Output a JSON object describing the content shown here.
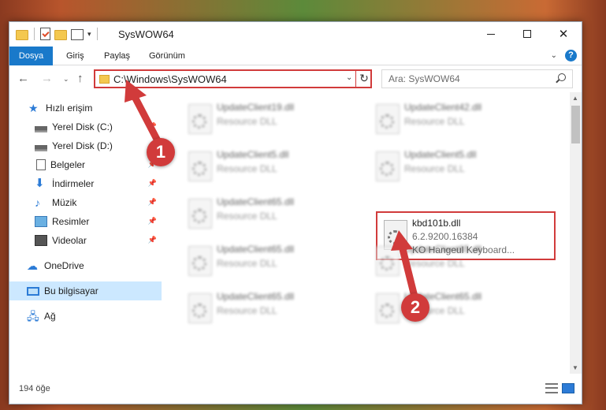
{
  "window": {
    "title": "SysWOW64",
    "controls": {
      "minimize": "–",
      "maximize": "□",
      "close": "✕"
    }
  },
  "ribbon": {
    "tabs": [
      {
        "label": "Dosya",
        "active": true
      },
      {
        "label": "Giriş"
      },
      {
        "label": "Paylaş"
      },
      {
        "label": "Görünüm"
      }
    ],
    "help": "?"
  },
  "nav": {
    "address": "C:\\Windows\\SysWOW64",
    "search_placeholder": "Ara: SysWOW64"
  },
  "sidebar": {
    "items": [
      {
        "label": "Hızlı erişim",
        "icon": "star-icon"
      },
      {
        "label": "Yerel Disk (C:)",
        "icon": "drive-icon",
        "pinned": true
      },
      {
        "label": "Yerel Disk (D:)",
        "icon": "drive-icon",
        "pinned": true
      },
      {
        "label": "Belgeler",
        "icon": "document-icon",
        "pinned": true
      },
      {
        "label": "İndirmeler",
        "icon": "download-icon",
        "pinned": true
      },
      {
        "label": "Müzik",
        "icon": "music-icon",
        "pinned": true
      },
      {
        "label": "Resimler",
        "icon": "pictures-icon",
        "pinned": true
      },
      {
        "label": "Videolar",
        "icon": "videos-icon",
        "pinned": true
      },
      {
        "label": "OneDrive",
        "icon": "cloud-icon"
      },
      {
        "label": "Bu bilgisayar",
        "icon": "computer-icon",
        "selected": true
      },
      {
        "label": "Ağ",
        "icon": "network-icon"
      }
    ]
  },
  "files": [
    {
      "name": "UpdateClient19.dll",
      "desc": "Resource DLL"
    },
    {
      "name": "UpdateClient42.dll",
      "desc": "Resource DLL"
    },
    {
      "name": "UpdateClient5.dll",
      "desc": "Resource DLL"
    },
    {
      "name": "UpdateClient5.dll",
      "desc": "Resource DLL"
    },
    {
      "name": "UpdateClient65.dll",
      "desc": "Resource DLL"
    },
    {
      "name": "kbd101b.dll",
      "desc": "6.2.9200.16384",
      "desc2": "KO Hangeul Keyboard...",
      "highlighted": true
    },
    {
      "name": "UpdateClient65.dll",
      "desc": "Resource DLL"
    },
    {
      "name": "UpdateClient65.dll",
      "desc": "Resource DLL"
    },
    {
      "name": "UpdateClient65.dll",
      "desc": "Resource DLL"
    },
    {
      "name": "UpdateClient65.dll",
      "desc": "Resource DLL"
    }
  ],
  "status": {
    "count": "194 öğe"
  },
  "annotations": {
    "step1": "1",
    "step2": "2",
    "color": "#d13b3b"
  }
}
